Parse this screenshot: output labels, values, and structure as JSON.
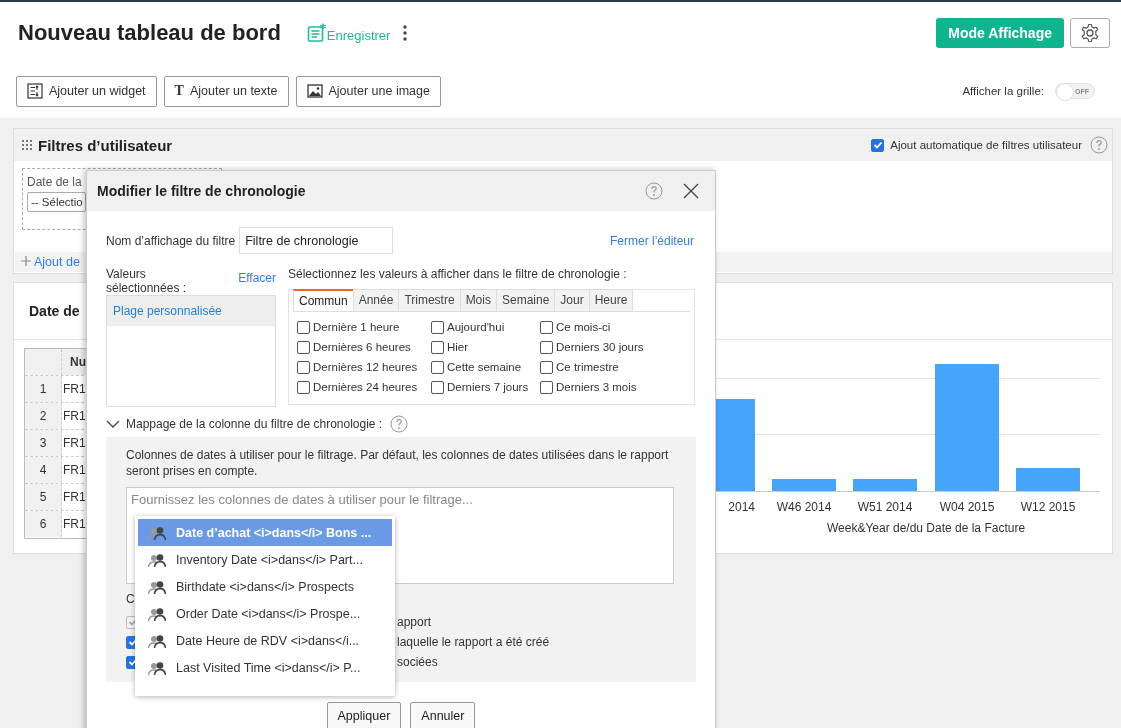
{
  "header": {
    "title": "Nouveau tableau de bord",
    "save_label": "Enregistrer",
    "mode_button": "Mode Affichage"
  },
  "toolbar": {
    "buttons": [
      {
        "kind": "widget",
        "label": "Ajouter un widget"
      },
      {
        "kind": "text",
        "glyph": "T",
        "label": "Ajouter un texte"
      },
      {
        "kind": "image",
        "label": "Ajouter une image"
      }
    ],
    "grid_label": "Afficher la grille:",
    "grid_toggle": {
      "on": false,
      "text": "OFF"
    }
  },
  "filters_panel": {
    "title": "Filtres d’utilisateur",
    "auto_add": {
      "label": "Ajout automatique de filtres utilisateur",
      "checked": true
    },
    "filter_label": "Date de la",
    "filter_select": "-- Sélectio",
    "add_link": "Ajout de"
  },
  "widget": {
    "title": "Date de",
    "table": {
      "header": "Nu",
      "rows": [
        {
          "number": "1",
          "cell": "FR1"
        },
        {
          "number": "2",
          "cell": "FR1"
        },
        {
          "number": "3",
          "cell": "FR1"
        },
        {
          "number": "4",
          "cell": "FR1"
        },
        {
          "number": "5",
          "cell": "FR1"
        },
        {
          "number": "6",
          "cell": "FR1"
        }
      ]
    },
    "chart": {
      "x_labels": [
        "2014",
        "W46 2014",
        "W51 2014",
        "W04 2015",
        "W12 2015"
      ],
      "axis_title": "Week&Year de/du Date de la Facture"
    }
  },
  "dialog": {
    "title": "Modifier le filtre de chronologie",
    "name_label": "Nom d’affichage du filtre",
    "name_value": "Filtre de chronologie",
    "selected_label": "Valeurs sélectionnées :",
    "clear_link": "Effacer",
    "selected_values": [
      {
        "label": "Plage personnalisée",
        "selected": true
      }
    ],
    "select_prompt": "Sélectionnez les valeurs à afficher dans le filtre de chronologie :",
    "close_editor_link": "Fermer l’éditeur",
    "tabs": [
      {
        "label": "Commun",
        "selected": true
      },
      {
        "label": "Année",
        "selected": false
      },
      {
        "label": "Trimestre",
        "selected": false
      },
      {
        "label": "Mois",
        "selected": false
      },
      {
        "label": "Semaine",
        "selected": false
      },
      {
        "label": "Jour",
        "selected": false
      },
      {
        "label": "Heure",
        "selected": false
      }
    ],
    "options": [
      {
        "label": "Dernière 1 heure",
        "checked": false
      },
      {
        "label": "Aujourd'hui",
        "checked": false
      },
      {
        "label": "Ce mois-ci",
        "checked": false
      },
      {
        "label": "Dernières 6 heures",
        "checked": false
      },
      {
        "label": "Hier",
        "checked": false
      },
      {
        "label": "Derniers 30 jours",
        "checked": false
      },
      {
        "label": "Dernières 12 heures",
        "checked": false
      },
      {
        "label": "Cette semaine",
        "checked": false
      },
      {
        "label": "Ce trimestre",
        "checked": false
      },
      {
        "label": "Dernières 24 heures",
        "checked": false
      },
      {
        "label": "Derniers 7 jours",
        "checked": false
      },
      {
        "label": "Derniers 3 mois",
        "checked": false
      }
    ],
    "mapping": {
      "title": "Mappage de la colonne du filtre de chronologie :",
      "expanded": true,
      "description": "Colonnes de dates à utiliser pour le filtrage. Par défaut, les colonnes de dates utilisées dans le rapport seront prises en compte.",
      "placeholder": "Fournissez les colonnes de dates à utiliser pour le filtrage...",
      "settings_heading": "C",
      "settings": [
        {
          "label": "apport",
          "checked": true,
          "disabled": true
        },
        {
          "label": "laquelle le rapport a été créé",
          "checked": true,
          "disabled": false
        },
        {
          "label": "sociées",
          "checked": true,
          "disabled": false
        }
      ]
    },
    "suggestions": [
      {
        "label": "Date d’achat <i>dans</i> Bons ...",
        "selected": true
      },
      {
        "label": "Inventory Date <i>dans</i> Part...",
        "selected": false
      },
      {
        "label": "Birthdate <i>dans</i> Prospects",
        "selected": false
      },
      {
        "label": "Order Date <i>dans</i> Prospe...",
        "selected": false
      },
      {
        "label": "Date Heure de RDV <i>dans</i...",
        "selected": false
      },
      {
        "label": "Last Visited Time <i>dans</i> P...",
        "selected": false
      }
    ],
    "buttons": [
      "Appliquer",
      "Annuler"
    ]
  }
}
